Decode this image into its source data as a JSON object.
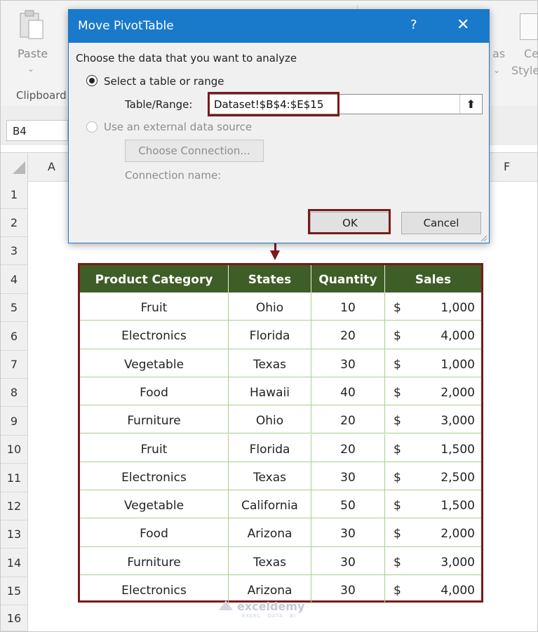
{
  "ribbon": {
    "paste_label": "Paste",
    "paste_caret": "⌄",
    "group_label": "Clipboard",
    "right_text_1": "as",
    "right_text_2": "Ce",
    "right_text_3": "Style",
    "right_caret": "⌄"
  },
  "formula_bar": {
    "name_box": "B4"
  },
  "columns": {
    "a": "A",
    "f": "F"
  },
  "rows": [
    "1",
    "2",
    "3",
    "4",
    "5",
    "6",
    "7",
    "8",
    "9",
    "10",
    "11",
    "12",
    "13",
    "14",
    "15",
    "16"
  ],
  "dialog": {
    "title": "Move PivotTable",
    "help": "?",
    "close": "✕",
    "prompt": "Choose the data that you want to analyze",
    "option_table": "Select a table or range",
    "range_label": "Table/Range:",
    "range_value": "Dataset!$B$4:$E$15",
    "collapse_glyph": "⬆",
    "option_external": "Use an external data source",
    "choose_connection": "Choose Connection...",
    "connection_name": "Connection name:",
    "ok": "OK",
    "cancel": "Cancel"
  },
  "table": {
    "headers": [
      "Product Category",
      "States",
      "Quantity",
      "Sales"
    ],
    "currency_symbol": "$",
    "rows": [
      [
        "Fruit",
        "Ohio",
        "10",
        "1,000"
      ],
      [
        "Electronics",
        "Florida",
        "20",
        "4,000"
      ],
      [
        "Vegetable",
        "Texas",
        "30",
        "1,000"
      ],
      [
        "Food",
        "Hawaii",
        "40",
        "2,000"
      ],
      [
        "Furniture",
        "Ohio",
        "20",
        "3,000"
      ],
      [
        "Fruit",
        "Florida",
        "20",
        "1,500"
      ],
      [
        "Electronics",
        "Texas",
        "30",
        "2,500"
      ],
      [
        "Vegetable",
        "California",
        "50",
        "1,500"
      ],
      [
        "Food",
        "Arizona",
        "30",
        "2,000"
      ],
      [
        "Furniture",
        "Texas",
        "30",
        "3,000"
      ],
      [
        "Electronics",
        "Arizona",
        "30",
        "4,000"
      ]
    ]
  },
  "watermark": {
    "name": "exceldemy",
    "tagline": "EXCEL · DATA · BI"
  },
  "colors": {
    "title_bar": "#1979ca",
    "header_fill": "#3f5d27",
    "highlight": "#7b1a1a",
    "grid_green": "#a9d08e"
  }
}
